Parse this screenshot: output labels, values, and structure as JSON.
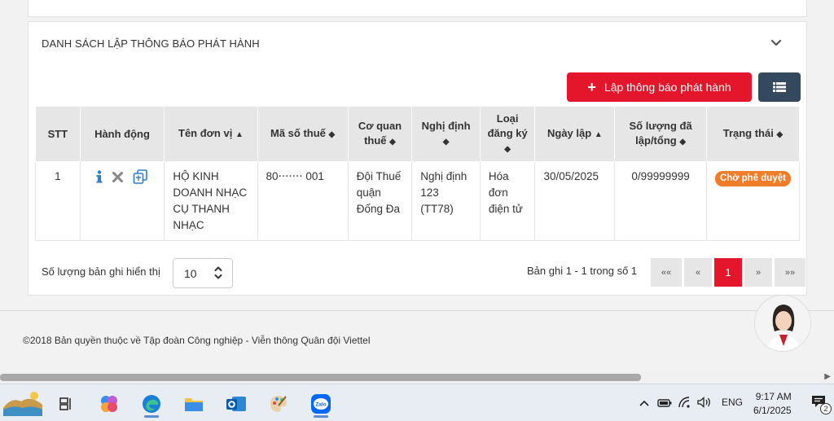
{
  "section": {
    "title": "DANH SÁCH LẬP THÔNG BÁO PHÁT HÀNH",
    "add_button_label": "Lập thông báo phát hành"
  },
  "table": {
    "headers": {
      "stt": "STT",
      "action": "Hành động",
      "unit_name": "Tên đơn vị",
      "tax_code": "Mã số thuế",
      "tax_office": "Cơ quan thuế",
      "decree": "Nghị định",
      "reg_type": "Loại đăng ký",
      "created_date": "Ngày lập",
      "quantity": "Số lượng đã lập/tổng",
      "status": "Trạng thái"
    },
    "rows": [
      {
        "stt": "1",
        "unit_name": "HỘ KINH DOANH NHẠC CỤ THANH NHẠC",
        "tax_code": "80‧‧‧‧‧‧‧ 001",
        "tax_office": "Đội Thuế quận Đống Đa",
        "decree": "Nghị định 123 (TT78)",
        "reg_type": "Hóa đơn điện tử",
        "created_date": "30/05/2025",
        "quantity": "0/99999999",
        "status": "Chờ phê duyệt"
      }
    ]
  },
  "pagination": {
    "per_page_label": "Số lượng bản ghi hiển thị",
    "per_page_value": "10",
    "record_info": "Bản ghi 1 - 1 trong số 1",
    "first": "««",
    "prev": "«",
    "current": "1",
    "next": "»",
    "last": "»»"
  },
  "footer": {
    "copyright": "©2018 Bản quyền thuộc về Tập đoàn Công nghiệp - Viễn thông Quân đội Viettel"
  },
  "taskbar": {
    "language": "ENG",
    "time": "9:17 AM",
    "date": "6/1/2025",
    "notification_count": "2",
    "zalo_label": "Zalo"
  },
  "colors": {
    "primary_red": "#e3162b",
    "dark_button": "#34495e",
    "status_orange": "#f07d2a",
    "info_blue": "#2f7dd1"
  }
}
